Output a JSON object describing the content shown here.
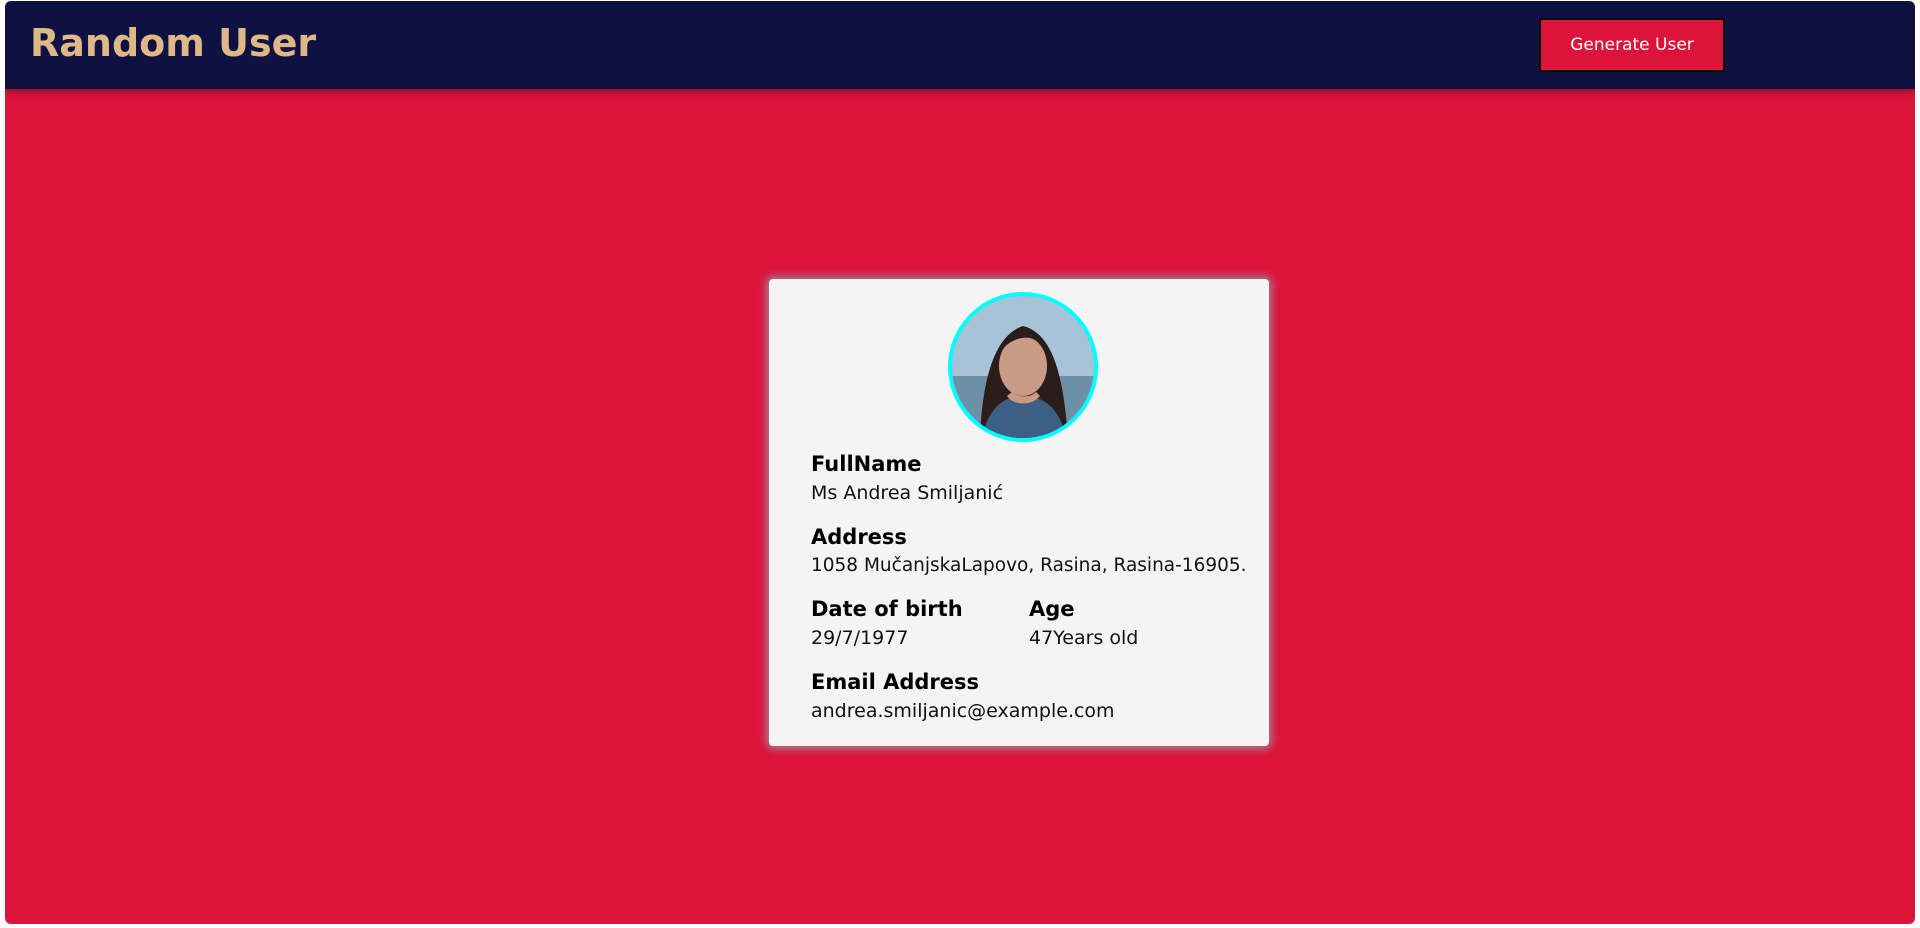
{
  "header": {
    "title": "Random User",
    "generate_button_label": "Generate User"
  },
  "colors": {
    "background": "#dc143c",
    "navbar": "#0f1143",
    "brand": "#deb887",
    "avatar_border": "#00ffff",
    "card": "#f4f4f4"
  },
  "user": {
    "avatar_alt": "user photo",
    "fullname_label": "FullName",
    "fullname": "Ms Andrea Smiljanić",
    "address_label": "Address",
    "address": "1058 MučanjskaLapovo, Rasina, Rasina-16905.",
    "dob_label": "Date of birth",
    "dob": "29/7/1977",
    "age_label": "Age",
    "age": "47Years old",
    "email_label": "Email Address",
    "email": "andrea.smiljanic@example.com"
  }
}
